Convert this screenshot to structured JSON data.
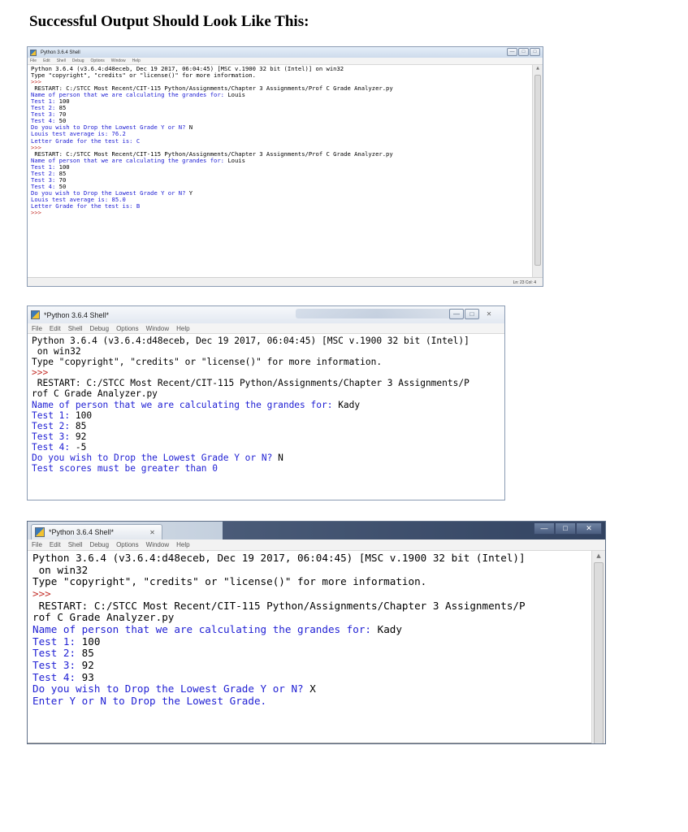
{
  "heading": "Successful Output Should Look Like This:",
  "menu": [
    "File",
    "Edit",
    "Shell",
    "Debug",
    "Options",
    "Window",
    "Help"
  ],
  "colors": {
    "prompt": "#c3302a",
    "output": "#2121d4",
    "input": "#000000"
  },
  "shots": [
    {
      "title": "Python 3.6.4 Shell",
      "status": "Ln: 23   Col: 4",
      "lines": [
        [
          {
            "t": "Python 3.6.4 (v3.6.4:d48eceb, Dec 19 2017, 06:04:45) [MSC v.1900 32 bit (Intel)] on win32",
            "c": "k"
          }
        ],
        [
          {
            "t": "Type \"copyright\", \"credits\" or \"license()\" for more information.",
            "c": "k"
          }
        ],
        [
          {
            "t": ">>> ",
            "c": "p"
          }
        ],
        [
          {
            "t": " RESTART: C:/STCC Most Recent/CIT-115 Python/Assignments/Chapter 3 Assignments/Prof C Grade Analyzer.py",
            "c": "k"
          }
        ],
        [
          {
            "t": "Name of person that we are calculating the grandes for: ",
            "c": "o"
          },
          {
            "t": "Louis",
            "c": "k"
          }
        ],
        [
          {
            "t": "Test 1: ",
            "c": "o"
          },
          {
            "t": "100",
            "c": "k"
          }
        ],
        [
          {
            "t": "Test 2: ",
            "c": "o"
          },
          {
            "t": "85",
            "c": "k"
          }
        ],
        [
          {
            "t": "Test 3: ",
            "c": "o"
          },
          {
            "t": "70",
            "c": "k"
          }
        ],
        [
          {
            "t": "Test 4: ",
            "c": "o"
          },
          {
            "t": "50",
            "c": "k"
          }
        ],
        [
          {
            "t": "Do you wish to Drop the Lowest Grade Y or N? ",
            "c": "o"
          },
          {
            "t": "N",
            "c": "k"
          }
        ],
        [
          {
            "t": "Louis test average is: 76.2",
            "c": "o"
          }
        ],
        [
          {
            "t": "Letter Grade for the test is: C",
            "c": "o"
          }
        ],
        [
          {
            "t": ">>> ",
            "c": "p"
          }
        ],
        [
          {
            "t": " RESTART: C:/STCC Most Recent/CIT-115 Python/Assignments/Chapter 3 Assignments/Prof C Grade Analyzer.py",
            "c": "k"
          }
        ],
        [
          {
            "t": "Name of person that we are calculating the grandes for: ",
            "c": "o"
          },
          {
            "t": "Louis",
            "c": "k"
          }
        ],
        [
          {
            "t": "Test 1: ",
            "c": "o"
          },
          {
            "t": "100",
            "c": "k"
          }
        ],
        [
          {
            "t": "Test 2: ",
            "c": "o"
          },
          {
            "t": "85",
            "c": "k"
          }
        ],
        [
          {
            "t": "Test 3: ",
            "c": "o"
          },
          {
            "t": "70",
            "c": "k"
          }
        ],
        [
          {
            "t": "Test 4: ",
            "c": "o"
          },
          {
            "t": "50",
            "c": "k"
          }
        ],
        [
          {
            "t": "Do you wish to Drop the Lowest Grade Y or N? ",
            "c": "o"
          },
          {
            "t": "Y",
            "c": "k"
          }
        ],
        [
          {
            "t": "Louis test average is: 85.0",
            "c": "o"
          }
        ],
        [
          {
            "t": "Letter Grade for the test is: B",
            "c": "o"
          }
        ],
        [
          {
            "t": ">>> ",
            "c": "p"
          }
        ]
      ]
    },
    {
      "title": "*Python 3.6.4 Shell*",
      "lines": [
        [
          {
            "t": "Python 3.6.4 (v3.6.4:d48eceb, Dec 19 2017, 06:04:45) [MSC v.1900 32 bit (Intel)]",
            "c": "k"
          }
        ],
        [
          {
            "t": " on win32",
            "c": "k"
          }
        ],
        [
          {
            "t": "Type \"copyright\", \"credits\" or \"license()\" for more information.",
            "c": "k"
          }
        ],
        [
          {
            "t": ">>> ",
            "c": "p"
          }
        ],
        [
          {
            "t": " RESTART: C:/STCC Most Recent/CIT-115 Python/Assignments/Chapter 3 Assignments/P",
            "c": "k"
          }
        ],
        [
          {
            "t": "rof C Grade Analyzer.py",
            "c": "k"
          }
        ],
        [
          {
            "t": "Name of person that we are calculating the grandes for: ",
            "c": "o"
          },
          {
            "t": "Kady",
            "c": "k"
          }
        ],
        [
          {
            "t": "Test 1: ",
            "c": "o"
          },
          {
            "t": "100",
            "c": "k"
          }
        ],
        [
          {
            "t": "Test 2: ",
            "c": "o"
          },
          {
            "t": "85",
            "c": "k"
          }
        ],
        [
          {
            "t": "Test 3: ",
            "c": "o"
          },
          {
            "t": "92",
            "c": "k"
          }
        ],
        [
          {
            "t": "Test 4: ",
            "c": "o"
          },
          {
            "t": "-5",
            "c": "k"
          }
        ],
        [
          {
            "t": "Do you wish to Drop the Lowest Grade Y or N? ",
            "c": "o"
          },
          {
            "t": "N",
            "c": "k"
          }
        ],
        [
          {
            "t": "Test scores must be greater than 0",
            "c": "o"
          }
        ]
      ]
    },
    {
      "title": "*Python 3.6.4 Shell*",
      "lines": [
        [
          {
            "t": "Python 3.6.4 (v3.6.4:d48eceb, Dec 19 2017, 06:04:45) [MSC v.1900 32 bit (Intel)]",
            "c": "k"
          }
        ],
        [
          {
            "t": " on win32",
            "c": "k"
          }
        ],
        [
          {
            "t": "Type \"copyright\", \"credits\" or \"license()\" for more information.",
            "c": "k"
          }
        ],
        [
          {
            "t": ">>> ",
            "c": "p"
          }
        ],
        [
          {
            "t": " RESTART: C:/STCC Most Recent/CIT-115 Python/Assignments/Chapter 3 Assignments/P",
            "c": "k"
          }
        ],
        [
          {
            "t": "rof C Grade Analyzer.py",
            "c": "k"
          }
        ],
        [
          {
            "t": "Name of person that we are calculating the grandes for: ",
            "c": "o"
          },
          {
            "t": "Kady",
            "c": "k"
          }
        ],
        [
          {
            "t": "Test 1: ",
            "c": "o"
          },
          {
            "t": "100",
            "c": "k"
          }
        ],
        [
          {
            "t": "Test 2: ",
            "c": "o"
          },
          {
            "t": "85",
            "c": "k"
          }
        ],
        [
          {
            "t": "Test 3: ",
            "c": "o"
          },
          {
            "t": "92",
            "c": "k"
          }
        ],
        [
          {
            "t": "Test 4: ",
            "c": "o"
          },
          {
            "t": "93",
            "c": "k"
          }
        ],
        [
          {
            "t": "Do you wish to Drop the Lowest Grade Y or N? ",
            "c": "o"
          },
          {
            "t": "X",
            "c": "k"
          }
        ],
        [
          {
            "t": "Enter Y or N to Drop the Lowest Grade.",
            "c": "o"
          }
        ]
      ]
    }
  ]
}
